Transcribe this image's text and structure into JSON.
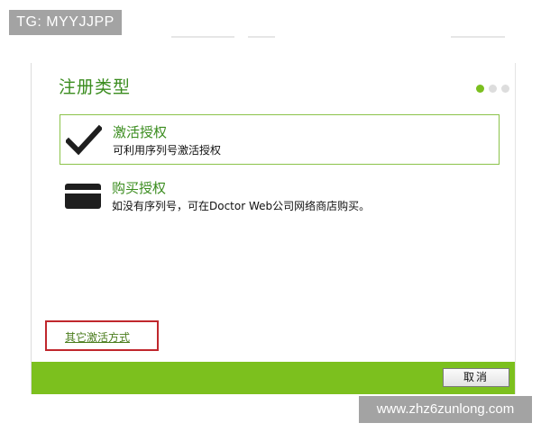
{
  "watermarks": {
    "top_left": "TG: MYYJJPP",
    "bottom_right": "www.zhz6zunlong.com"
  },
  "dialog": {
    "title": "注册类型",
    "steps": {
      "total": 3,
      "current": 1
    },
    "options": [
      {
        "icon": "checkmark-icon",
        "title": "激活授权",
        "description": "可利用序列号激活授权",
        "selected": true
      },
      {
        "icon": "credit-card-icon",
        "title": "购买授权",
        "description": "如没有序列号，可在Doctor Web公司网络商店购买。",
        "selected": false
      }
    ],
    "other_activation_link": "其它激活方式",
    "cancel_button": "取消"
  },
  "colors": {
    "accent_green": "#7cc01e",
    "title_green": "#3a8c1e",
    "highlight_red": "#c0272d"
  }
}
